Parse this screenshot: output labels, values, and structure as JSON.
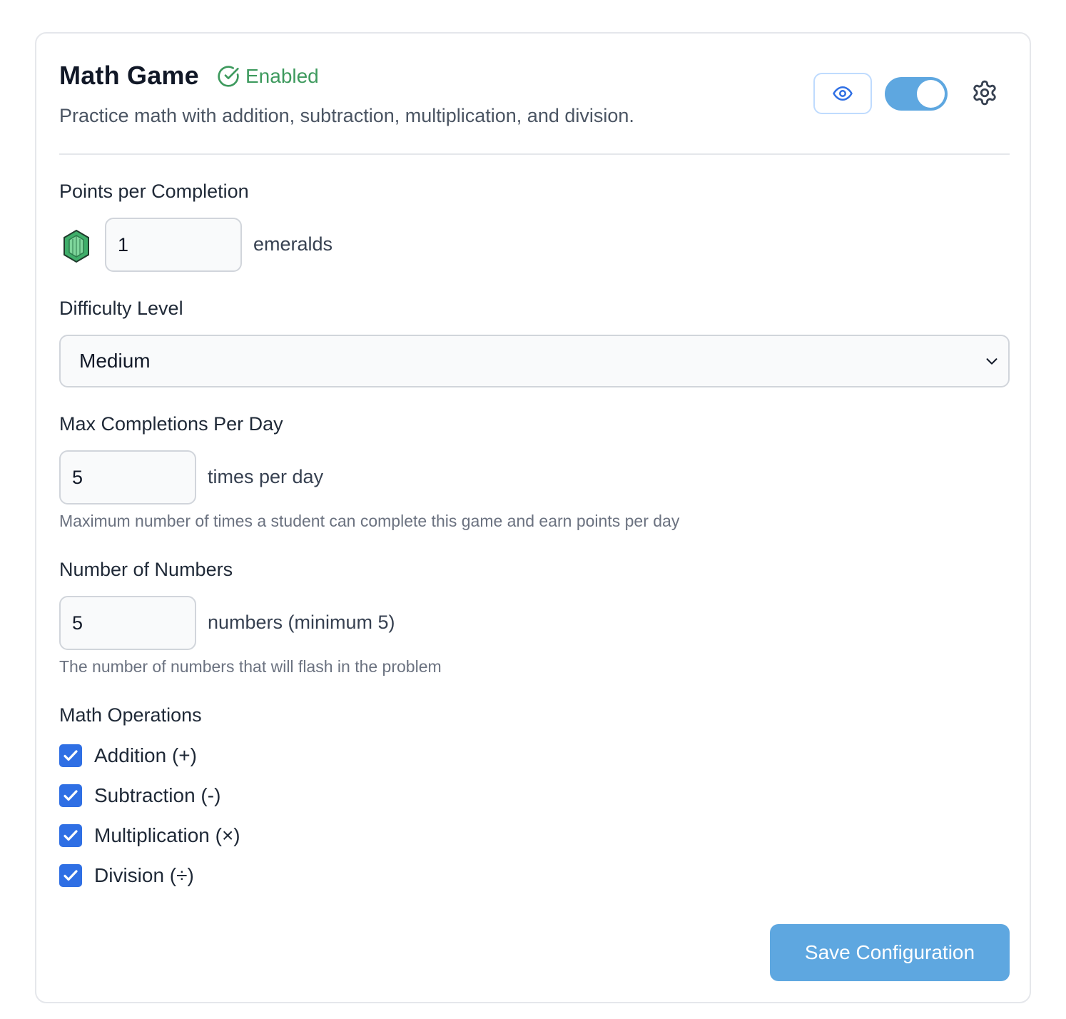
{
  "header": {
    "title": "Math Game",
    "status": "Enabled",
    "description": "Practice math with addition, subtraction, multiplication, and division.",
    "preview_icon": "eye-icon",
    "enabled_toggle": true,
    "settings_icon": "gear-icon"
  },
  "points": {
    "label": "Points per Completion",
    "icon": "emerald-icon",
    "value": "1",
    "unit": "emeralds"
  },
  "difficulty": {
    "label": "Difficulty Level",
    "selected": "Medium"
  },
  "max_completions": {
    "label": "Max Completions Per Day",
    "value": "5",
    "unit": "times per day",
    "help": "Maximum number of times a student can complete this game and earn points per day"
  },
  "number_count": {
    "label": "Number of Numbers",
    "value": "5",
    "unit": "numbers (minimum 5)",
    "help": "The number of numbers that will flash in the problem"
  },
  "operations": {
    "label": "Math Operations",
    "items": [
      {
        "label": "Addition (+)",
        "checked": true
      },
      {
        "label": "Subtraction (-)",
        "checked": true
      },
      {
        "label": "Multiplication (×)",
        "checked": true
      },
      {
        "label": "Division (÷)",
        "checked": true
      }
    ]
  },
  "actions": {
    "save_label": "Save Configuration"
  },
  "colors": {
    "accent": "#5ea7e0",
    "checkbox": "#2f6fe4",
    "enabled_green": "#3e9a5e"
  }
}
